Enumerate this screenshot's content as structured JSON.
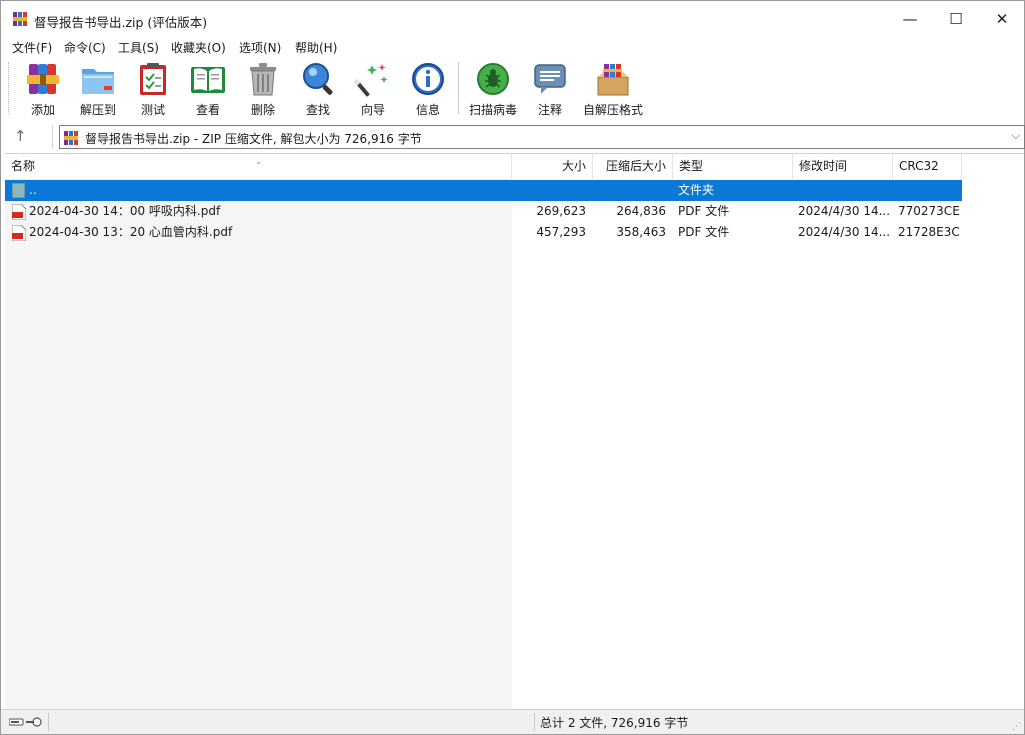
{
  "window": {
    "title": "督导报告书导出.zip (评估版本)",
    "minimize_glyph": "—",
    "maximize_glyph": "☐",
    "close_glyph": "✕"
  },
  "menu": [
    {
      "label": "文件(F)"
    },
    {
      "label": "命令(C)"
    },
    {
      "label": "工具(S)"
    },
    {
      "label": "收藏夹(O)"
    },
    {
      "label": "选项(N)"
    },
    {
      "label": "帮助(H)"
    }
  ],
  "toolbar": [
    {
      "label": "添加",
      "icon": "add-archive-icon"
    },
    {
      "label": "解压到",
      "icon": "extract-folder-icon"
    },
    {
      "label": "测试",
      "icon": "test-clipboard-icon"
    },
    {
      "label": "查看",
      "icon": "view-book-icon"
    },
    {
      "label": "删除",
      "icon": "trash-icon"
    },
    {
      "label": "查找",
      "icon": "find-magnifier-icon"
    },
    {
      "label": "向导",
      "icon": "wizard-wand-icon"
    },
    {
      "label": "信息",
      "icon": "info-icon"
    },
    {
      "label": "扫描病毒",
      "icon": "virus-scan-icon"
    },
    {
      "label": "注释",
      "icon": "comment-icon"
    },
    {
      "label": "自解压格式",
      "icon": "sfx-box-icon"
    }
  ],
  "address": {
    "up_glyph": "↑",
    "path_text": "督导报告书导出.zip - ZIP 压缩文件, 解包大小为 726,916 字节",
    "dropdown_glyph": "⌵"
  },
  "columns": {
    "name": "名称",
    "size": "大小",
    "packed": "压缩后大小",
    "type": "类型",
    "modified": "修改时间",
    "crc": "CRC32"
  },
  "rows": [
    {
      "name": "..",
      "size": "",
      "packed": "",
      "type": "文件夹",
      "modified": "",
      "crc": ""
    },
    {
      "name": "2024-04-30 14：00 呼吸内科.pdf",
      "size": "269,623",
      "packed": "264,836",
      "type": "PDF 文件",
      "modified": "2024/4/30 14...",
      "crc": "770273CE"
    },
    {
      "name": "2024-04-30 13：20 心血管内科.pdf",
      "size": "457,293",
      "packed": "358,463",
      "type": "PDF 文件",
      "modified": "2024/4/30 14...",
      "crc": "21728E3C"
    }
  ],
  "status": {
    "summary": "总计 2 文件, 726,916 字节"
  },
  "colors": {
    "selection": "#0b78d7",
    "window_bg": "#ffffff",
    "status_bg": "#f0f0f0"
  }
}
